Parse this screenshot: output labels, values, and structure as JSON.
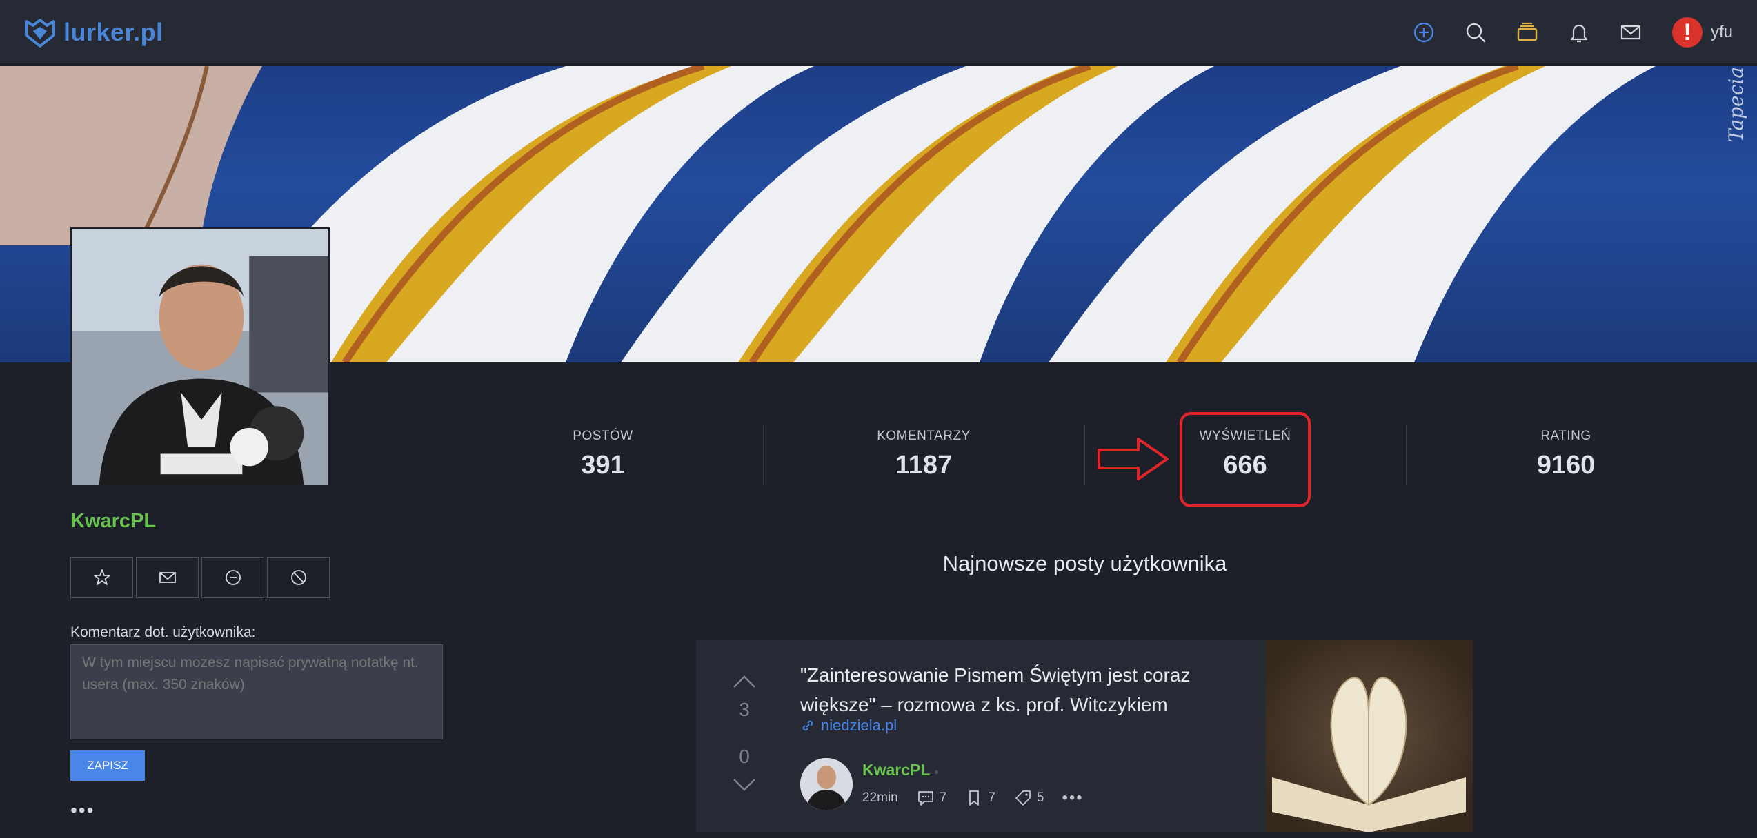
{
  "brand": {
    "name": "lurker.pl"
  },
  "nav": {
    "user_name": "yfu",
    "user_avatar_glyph": "!"
  },
  "banner": {
    "watermark": "Tapeciarnia.pl"
  },
  "profile": {
    "username": "KwarcPL",
    "note_label": "Komentarz dot. użytkownika:",
    "note_placeholder": "W tym miejscu możesz napisać prywatną notatkę nt. usera (max. 350 znaków)",
    "save_label": "ZAPISZ",
    "more_label": "•••"
  },
  "stats": [
    {
      "label": "POSTÓW",
      "value": "391"
    },
    {
      "label": "KOMENTARZY",
      "value": "1187"
    },
    {
      "label": "WYŚWIETLEŃ",
      "value": "666"
    },
    {
      "label": "RATING",
      "value": "9160"
    }
  ],
  "posts_section": {
    "title": "Najnowsze posty użytkownika"
  },
  "post": {
    "title": "\"Zainteresowanie Pismem Świętym jest coraz większe\" – rozmowa z ks. prof. Witczykiem",
    "link": "niedziela.pl",
    "upvotes": "3",
    "downvotes": "0",
    "author": "KwarcPL",
    "time": "22min",
    "comments": "7",
    "bookmarks": "7",
    "tags": "5",
    "more": "•••"
  },
  "colors": {
    "accent": "#4a86e8",
    "username": "#67c24e",
    "highlight": "#e0252a",
    "background": "#1e2029"
  },
  "icons": [
    "shield-logo-icon",
    "plus-circle-icon",
    "search-icon",
    "folder-icon",
    "bell-icon",
    "mail-icon",
    "star-icon",
    "minus-circle-icon",
    "block-icon",
    "link-icon",
    "comment-icon",
    "bookmark-icon",
    "tag-icon",
    "arrow-right-icon"
  ]
}
